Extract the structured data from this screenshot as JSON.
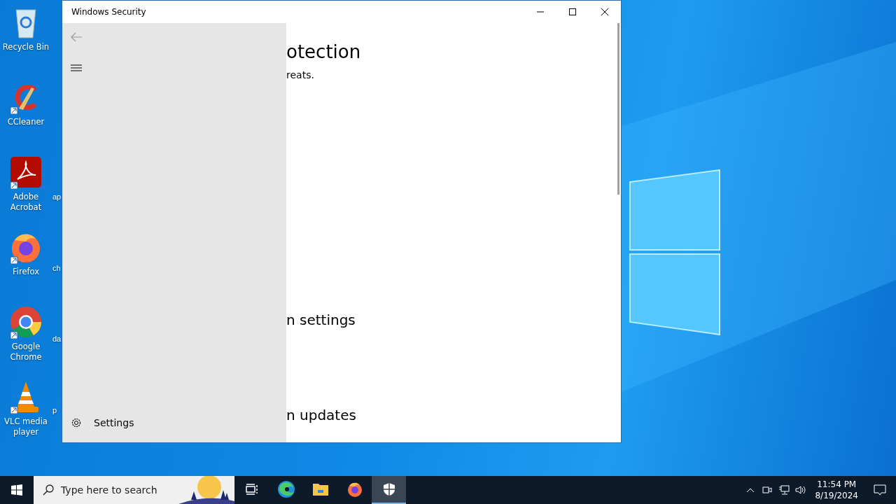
{
  "desktop": {
    "icons": [
      {
        "kind": "recycle",
        "label": "Recycle Bin"
      },
      {
        "kind": "ccleaner",
        "label": "CCleaner"
      },
      {
        "kind": "acrobat",
        "label": "Adobe Acrobat"
      },
      {
        "kind": "firefox",
        "label": "Firefox"
      },
      {
        "kind": "chrome",
        "label": "Google Chrome"
      },
      {
        "kind": "vlc",
        "label": "VLC media player"
      }
    ],
    "column_2_labels": [
      "ap",
      "ch",
      "da",
      "p"
    ]
  },
  "window": {
    "title": "Windows Security",
    "nav": {
      "settings": "Settings"
    },
    "content": [
      {
        "kind": "title",
        "text": "otection"
      },
      {
        "kind": "subtitle",
        "text": "reats."
      },
      {
        "kind": "section",
        "text": "n settings"
      },
      {
        "kind": "section",
        "text": "n updates"
      }
    ]
  },
  "taskbar": {
    "search": {
      "placeholder": "Type here to search"
    },
    "apps": [
      {
        "kind": "taskview",
        "selected": false
      },
      {
        "kind": "edge",
        "selected": false
      },
      {
        "kind": "explorer",
        "selected": false
      },
      {
        "kind": "firefox",
        "selected": false
      },
      {
        "kind": "security",
        "selected": true
      }
    ],
    "time": "11:54 PM",
    "date": "8/19/2024"
  }
}
